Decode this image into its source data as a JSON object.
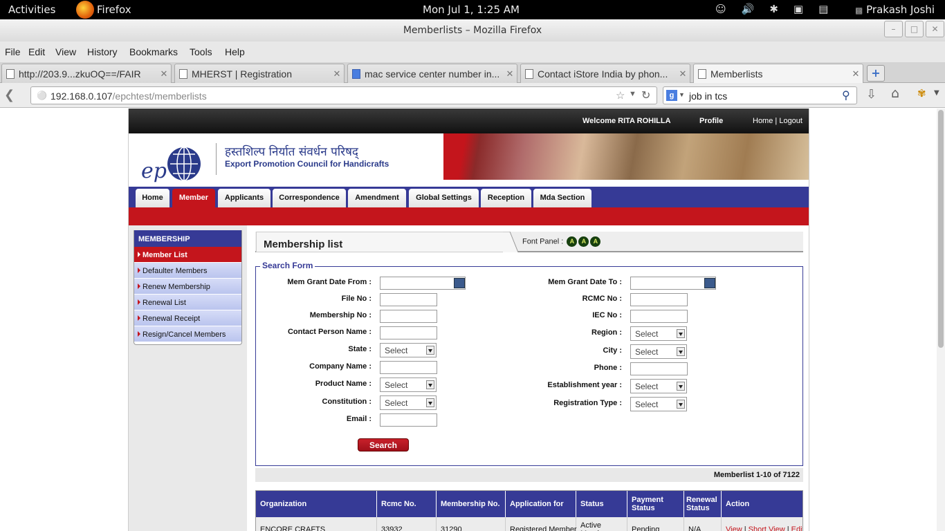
{
  "desktop": {
    "activities": "Activities",
    "app": "Firefox",
    "clock": "Mon Jul  1,  1:25 AM",
    "user": "Prakash Joshi"
  },
  "window": {
    "title": "Memberlists – Mozilla Firefox"
  },
  "menu": [
    "File",
    "Edit",
    "View",
    "History",
    "Bookmarks",
    "Tools",
    "Help"
  ],
  "tabs": [
    {
      "label": "http://203.9...zkuOQ==/FAIR",
      "favicon": "page-icon"
    },
    {
      "label": "MHERST | Registration",
      "favicon": "page-icon"
    },
    {
      "label": "mac service center number in...",
      "favicon": "google-icon"
    },
    {
      "label": "Contact iStore India by phon...",
      "favicon": "page-icon"
    },
    {
      "label": "Memberlists",
      "favicon": "page-icon"
    }
  ],
  "url": {
    "host": "192.168.0.107",
    "path": "/epchtest/memberlists"
  },
  "search": {
    "query": "job in tcs"
  },
  "site": {
    "welcome": "Welcome RITA ROHILLA",
    "profile": "Profile",
    "home": "Home",
    "sep": "|",
    "logout": "Logout",
    "org_hindi": "हस्तशिल्प निर्यात संवर्धन परिषद्",
    "org_english": "Export Promotion Council for Handicrafts",
    "nav": [
      "Home",
      "Member",
      "Applicants",
      "Correspondence",
      "Amendment",
      "Global Settings",
      "Reception",
      "Mda Section"
    ],
    "sidebar": {
      "title": "MEMBERSHIP",
      "items": [
        "Member List",
        "Defaulter Members",
        "Renew Membership",
        "Renewal List",
        "Renewal Receipt",
        "Resign/Cancel Members"
      ]
    },
    "page_title": "Membership list",
    "font_panel": "Font Panel :",
    "font_a": "A",
    "form": {
      "legend": "Search Form",
      "left": {
        "grant_from": "Mem Grant Date From :",
        "file_no": "File No :",
        "membership_no": "Membership No :",
        "contact": "Contact Person Name :",
        "state": "State :",
        "company": "Company Name :",
        "product": "Product Name :",
        "constitution": "Constitution :",
        "email": "Email :"
      },
      "right": {
        "grant_to": "Mem Grant Date To :",
        "rcmc": "RCMC No :",
        "iec": "IEC No :",
        "region": "Region :",
        "city": "City :",
        "phone": "Phone :",
        "estab": "Establishment year :",
        "regtype": "Registration Type :"
      },
      "select_placeholder": "Select",
      "search_button": "Search"
    },
    "count_text": "Memberlist 1-10 of 7122",
    "table": {
      "headers": [
        "Organization",
        "Rcmc No.",
        "Membership No.",
        "Application for",
        "Status",
        "Payment Status",
        "Renewal Status",
        "Action"
      ],
      "rows": [
        {
          "org": "ENCORE CRAFTS",
          "rcmc": "33932",
          "membership": "31290",
          "application": "Registered Member",
          "status": "Active Member",
          "payment": "Pending",
          "renewal": "N/A",
          "view": "View",
          "short_view": "Short View",
          "edit": "Edit"
        }
      ]
    }
  }
}
